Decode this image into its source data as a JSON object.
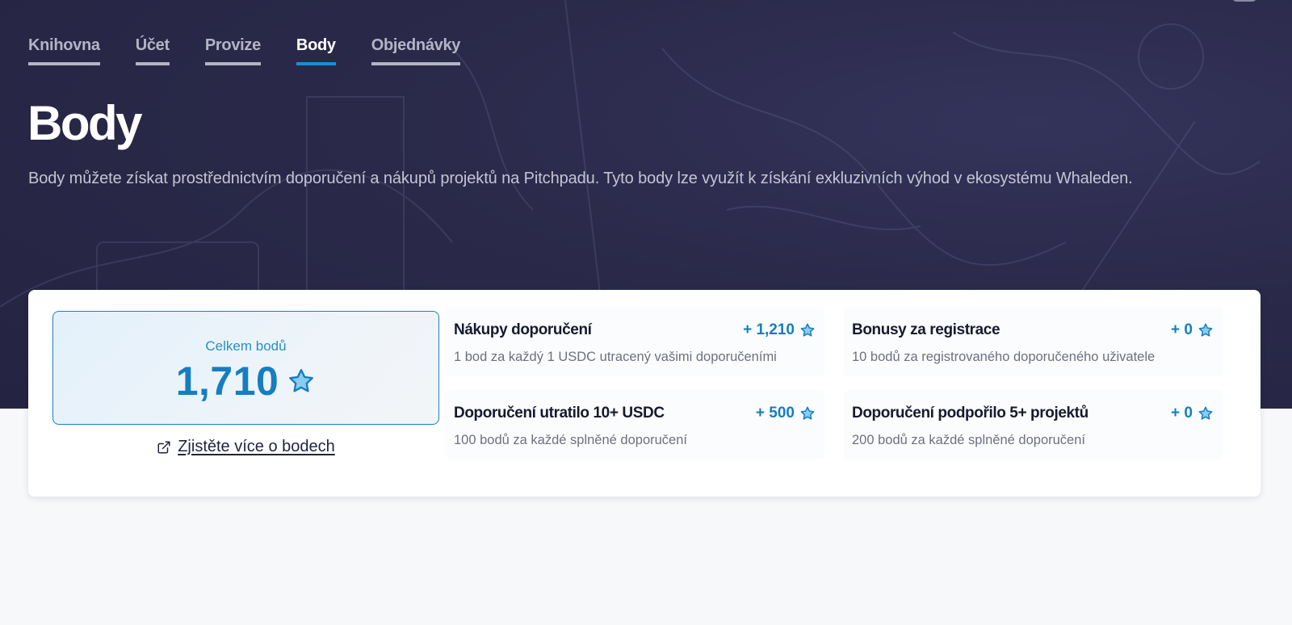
{
  "tabs": [
    {
      "label": "Knihovna",
      "active": false
    },
    {
      "label": "Účet",
      "active": false
    },
    {
      "label": "Provize",
      "active": false
    },
    {
      "label": "Body",
      "active": true
    },
    {
      "label": "Objednávky",
      "active": false
    }
  ],
  "header": {
    "title": "Body",
    "description": "Body můžete získat prostřednictvím doporučení a nákupů projektů na Pitchpadu. Tyto body lze využít k získání exkluzivních výhod v ekosystému Whaleden."
  },
  "summary": {
    "total_label": "Celkem bodů",
    "total_value": "1,710",
    "learn_more": "Zjistěte více o bodech"
  },
  "stats": [
    {
      "title": "Nákupy doporučení",
      "value": "+ 1,210",
      "description": "1 bod za každý 1 USDC utracený vašimi doporučeními"
    },
    {
      "title": "Bonusy za registrace",
      "value": "+ 0",
      "description": "10 bodů za registrovaného doporučeného uživatele"
    },
    {
      "title": "Doporučení utratilo 10+ USDC",
      "value": "+ 500",
      "description": "100 bodů za každé splněné doporučení"
    },
    {
      "title": "Doporučení podpořilo 5+ projektů",
      "value": "+ 0",
      "description": "200 bodů za každé splněné doporučení"
    }
  ],
  "icons": {
    "star": "star-icon",
    "external": "external-link-icon"
  },
  "colors": {
    "accent": "#167ec0",
    "hero_bg": "#2a2949",
    "active_tab_underline": "#1a8ed0"
  }
}
